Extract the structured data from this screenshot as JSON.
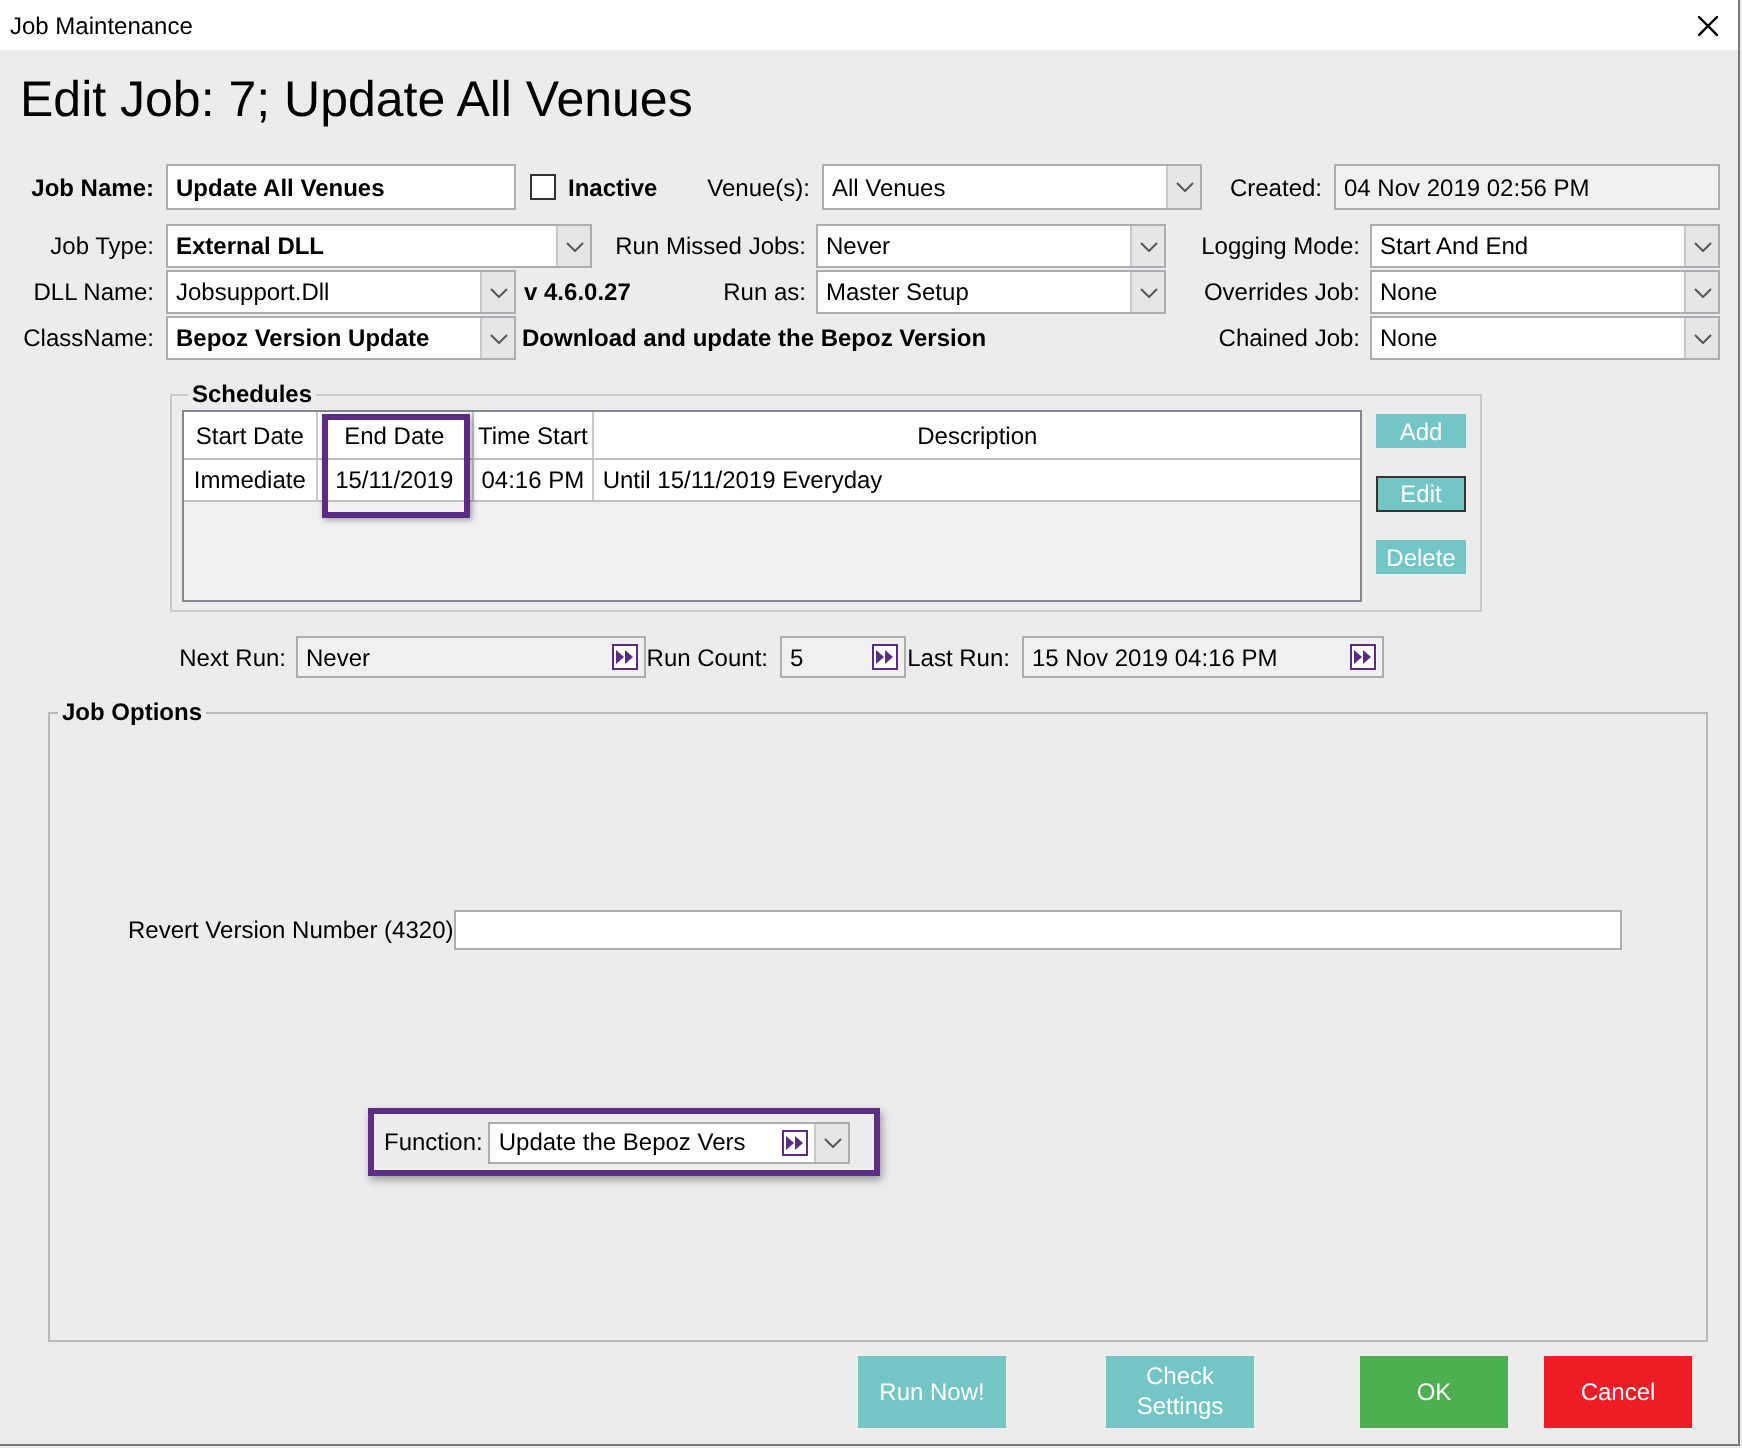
{
  "window": {
    "title": "Job Maintenance"
  },
  "heading": "Edit Job: 7; Update All Venues",
  "form_rows": [
    [
      {
        "kind": "label",
        "text": "Job Name:",
        "bold": true
      },
      {
        "kind": "input",
        "value": "Update All Venues",
        "bold": true
      },
      {
        "kind": "checkbox",
        "label": "Inactive",
        "checked": false
      },
      {
        "kind": "label",
        "text": "Venue(s):",
        "bold": false
      },
      {
        "kind": "combo",
        "value": "All Venues",
        "bold": false
      },
      {
        "kind": "label",
        "text": "Created:",
        "bold": false
      },
      {
        "kind": "readonly",
        "value": "04 Nov 2019 02:56 PM"
      }
    ],
    [
      {
        "kind": "label",
        "text": "Job Type:",
        "bold": false
      },
      {
        "kind": "combo",
        "value": "External DLL",
        "bold": true
      },
      {
        "kind": "label",
        "text": "Run Missed Jobs:",
        "bold": false
      },
      {
        "kind": "combo",
        "value": "Never",
        "bold": false
      },
      {
        "kind": "label",
        "text": "Logging Mode:",
        "bold": false
      },
      {
        "kind": "combo",
        "value": "Start And End",
        "bold": false
      }
    ],
    [
      {
        "kind": "label",
        "text": "DLL Name:",
        "bold": false
      },
      {
        "kind": "combo",
        "value": "Jobsupport.Dll",
        "bold": false
      },
      {
        "kind": "note",
        "text": "v 4.6.0.27",
        "bold": true
      },
      {
        "kind": "label",
        "text": "Run as:",
        "bold": false
      },
      {
        "kind": "combo",
        "value": "Master Setup",
        "bold": false
      },
      {
        "kind": "label",
        "text": "Overrides Job:",
        "bold": false
      },
      {
        "kind": "combo",
        "value": "None",
        "bold": false
      }
    ],
    [
      {
        "kind": "label",
        "text": "ClassName:",
        "bold": false
      },
      {
        "kind": "combo",
        "value": "Bepoz Version Update",
        "bold": true
      },
      {
        "kind": "note",
        "text": "Download and update the Bepoz Version",
        "bold": true
      },
      {
        "kind": "label",
        "text": "Chained Job:",
        "bold": false
      },
      {
        "kind": "combo",
        "value": "None",
        "bold": false
      }
    ]
  ],
  "schedules": {
    "title": "Schedules",
    "columns": [
      {
        "label": "Start Date",
        "highlighted": false
      },
      {
        "label": "End Date",
        "highlighted": true
      },
      {
        "label": "Time Start",
        "highlighted": false
      },
      {
        "label": "Description",
        "highlighted": false
      }
    ],
    "rows": [
      [
        "Immediate",
        "15/11/2019",
        "04:16 PM",
        "Until 15/11/2019 Everyday"
      ]
    ],
    "buttons": [
      {
        "label": "Add",
        "focused": false
      },
      {
        "label": "Edit",
        "focused": true
      },
      {
        "label": "Delete",
        "focused": false
      }
    ]
  },
  "run_info": [
    {
      "label": "Next Run:",
      "value": "Never"
    },
    {
      "label": "Run Count:",
      "value": "5"
    },
    {
      "label": "Last Run:",
      "value": "15 Nov 2019 04:16 PM"
    }
  ],
  "job_options": {
    "title": "Job Options",
    "revert_label": "Revert Version Number (4320)",
    "function": {
      "label": "Function:",
      "value": "Update the Bepoz Vers",
      "highlighted": true
    }
  },
  "actions": [
    {
      "label": "Run Now!",
      "kind": "secondary"
    },
    {
      "label": "Check Settings",
      "kind": "secondary"
    },
    {
      "label": "OK",
      "kind": "confirm"
    },
    {
      "label": "Cancel",
      "kind": "cancel"
    }
  ]
}
